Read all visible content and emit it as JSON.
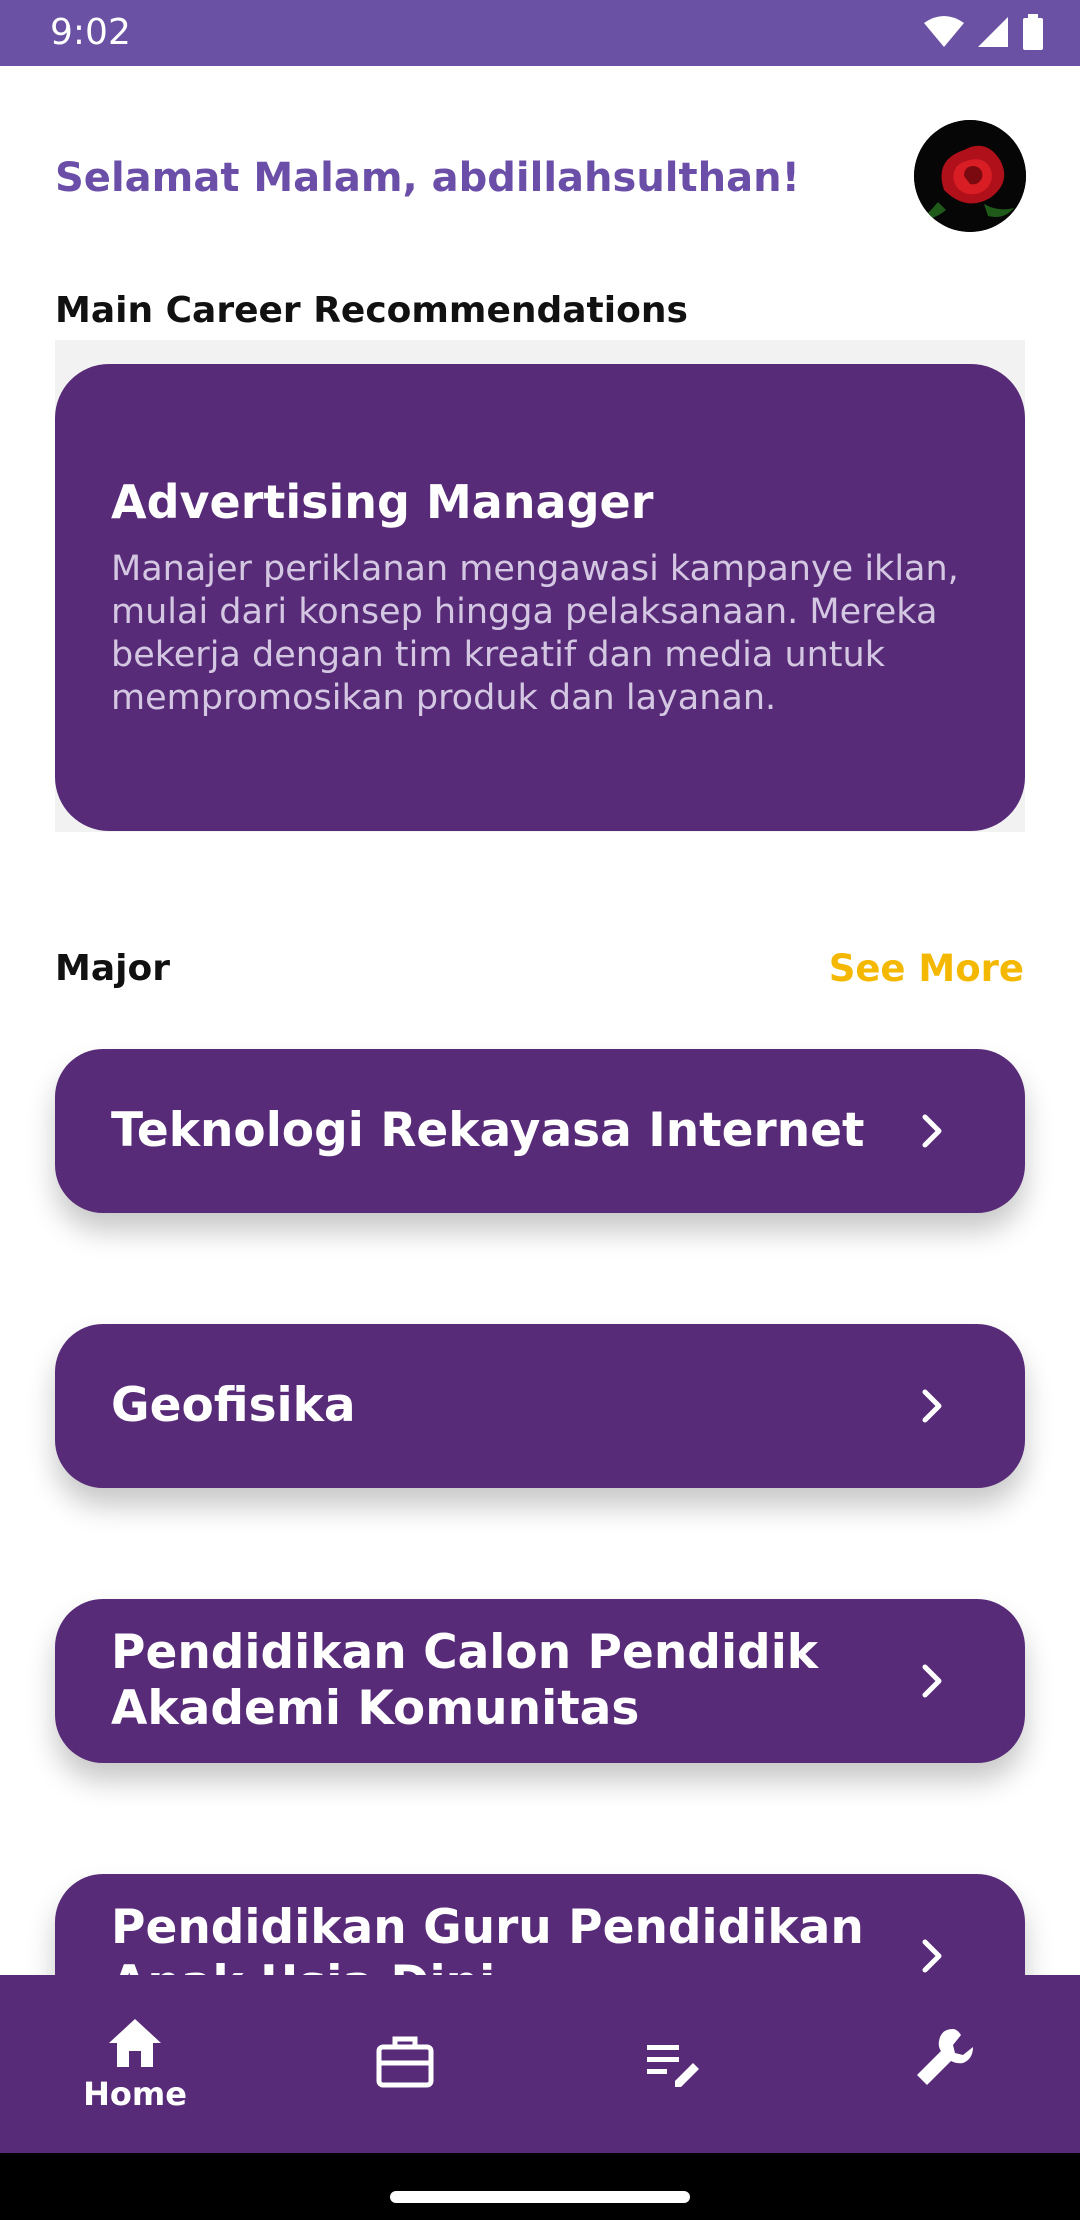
{
  "status_bar": {
    "time": "9:02",
    "icons": [
      "wifi-icon",
      "signal-icon",
      "battery-icon"
    ]
  },
  "header": {
    "greeting": "Selamat Malam, abdillahsulthan!",
    "avatar": "rose-avatar"
  },
  "career": {
    "section_title": "Main Career Recommendations",
    "card_title": "Advertising Manager",
    "card_description": "Manajer periklanan mengawasi kampanye iklan, mulai dari konsep hingga pelaksanaan. Mereka bekerja dengan tim kreatif dan media untuk mempromosikan produk dan layanan."
  },
  "major": {
    "section_title": "Major",
    "see_more": "See More",
    "items": [
      {
        "label": "Teknologi Rekayasa Internet"
      },
      {
        "label": "Geofisika"
      },
      {
        "label": "Pendidikan Calon Pendidik Akademi Komunitas"
      },
      {
        "label": "Pendidikan Guru Pendidikan Anak Usia Dini"
      }
    ]
  },
  "bottom_nav": {
    "items": [
      {
        "icon": "home-icon",
        "label": "Home",
        "active": true
      },
      {
        "icon": "briefcase-icon",
        "label": ""
      },
      {
        "icon": "edit-list-icon",
        "label": ""
      },
      {
        "icon": "wrench-icon",
        "label": ""
      }
    ]
  },
  "colors": {
    "status_bar": "#6a51a3",
    "primary": "#582b79",
    "greeting": "#6a4ea8",
    "accent": "#f5b800"
  }
}
